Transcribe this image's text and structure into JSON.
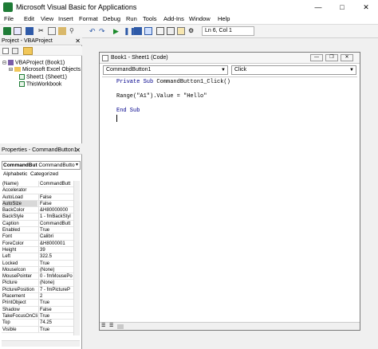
{
  "app": {
    "title": "Microsoft Visual Basic for Applications"
  },
  "menu": [
    "File",
    "Edit",
    "View",
    "Insert",
    "Format",
    "Debug",
    "Run",
    "Tools",
    "Add-Ins",
    "Window",
    "Help"
  ],
  "toolbar": {
    "position": "Ln 6, Col 1"
  },
  "project": {
    "title": "Project - VBAProject",
    "root": "VBAProject (Book1)",
    "folder": "Microsoft Excel Objects",
    "items": [
      "Sheet1 (Sheet1)",
      "ThisWorkbook"
    ]
  },
  "properties": {
    "title": "Properties - CommandButton1",
    "selector_name": "CommandBut",
    "selector_type": "CommandButto",
    "tabs": [
      "Alphabetic",
      "Categorized"
    ],
    "rows": [
      {
        "k": "(Name)",
        "v": "CommandButt"
      },
      {
        "k": "Accelerator",
        "v": ""
      },
      {
        "k": "AutoLoad",
        "v": "False"
      },
      {
        "k": "AutoSize",
        "v": "False"
      },
      {
        "k": "BackColor",
        "v": "&H80000000"
      },
      {
        "k": "BackStyle",
        "v": "1 - fmBackStyl"
      },
      {
        "k": "Caption",
        "v": "CommandButt"
      },
      {
        "k": "Enabled",
        "v": "True"
      },
      {
        "k": "Font",
        "v": "Calibri"
      },
      {
        "k": "ForeColor",
        "v": "&H8000001"
      },
      {
        "k": "Height",
        "v": "39"
      },
      {
        "k": "Left",
        "v": "322.5"
      },
      {
        "k": "Locked",
        "v": "True"
      },
      {
        "k": "MouseIcon",
        "v": "(None)"
      },
      {
        "k": "MousePointer",
        "v": "0 - fmMousePo"
      },
      {
        "k": "Picture",
        "v": "(None)"
      },
      {
        "k": "PicturePosition",
        "v": "7 - fmPictureP"
      },
      {
        "k": "Placement",
        "v": "2"
      },
      {
        "k": "PrintObject",
        "v": "True"
      },
      {
        "k": "Shadow",
        "v": "False"
      },
      {
        "k": "TakeFocusOnClick",
        "v": "True"
      },
      {
        "k": "Top",
        "v": "74.25"
      },
      {
        "k": "Visible",
        "v": "True"
      }
    ]
  },
  "code_window": {
    "title": "Book1 - Sheet1 (Code)",
    "object": "CommandButton1",
    "procedure": "Click",
    "lines": [
      "Private Sub CommandButton1_Click()",
      "",
      "Range(\"A1\").Value = \"Hello\"",
      "",
      "End Sub"
    ]
  }
}
